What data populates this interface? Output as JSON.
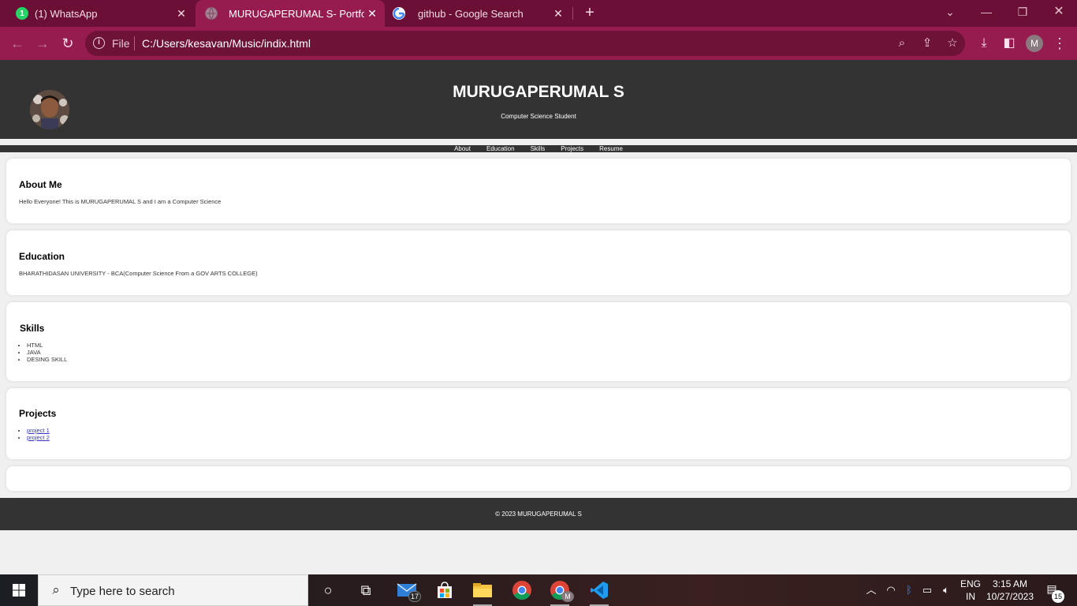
{
  "browser": {
    "tabs": [
      {
        "title": "(1) WhatsApp",
        "icon": "whatsapp-icon",
        "badge": "1",
        "active": false
      },
      {
        "title": "MURUGAPERUMAL S- Portfolio",
        "icon": "globe-icon",
        "active": true
      },
      {
        "title": "github - Google Search",
        "icon": "google-icon",
        "active": false
      }
    ],
    "new_tab": "+",
    "address": {
      "scheme_label": "File",
      "url": "C:/Users/kesavan/Music/indix.html"
    },
    "profile_initial": "M",
    "colors": {
      "frame": "#6b0f36",
      "toolbar": "#961b4f",
      "omnibox": "#6f1238"
    }
  },
  "site": {
    "header": {
      "title": "MURUGAPERUMAL S",
      "subtitle": "Computer Science Student"
    },
    "nav": [
      "About",
      "Education",
      "Skills",
      "Projects",
      "Resume"
    ],
    "about": {
      "heading": "About Me",
      "text": "Hello Everyone! This is MURUGAPERUMAL S and I am a Computer Science"
    },
    "education": {
      "heading": "Education",
      "text": "BHARATHIDASAN UNIVERSITY - BCA(Computer Science From a GOV ARTS COLLEGE)"
    },
    "skills": {
      "heading": "Skills",
      "items": [
        "HTML",
        "JAVA",
        "DESING SKILL"
      ]
    },
    "projects": {
      "heading": "Projects",
      "items": [
        "project 1",
        "project 2"
      ]
    },
    "footer": "© 2023 MURUGAPERUMAL S",
    "colors": {
      "header_bg": "#333333",
      "page_bg": "#f0f0f0",
      "link": "#3333cc"
    }
  },
  "taskbar": {
    "search_placeholder": "Type here to search",
    "mail_badge": "17",
    "chrome_profile_badge": "M",
    "language": {
      "line1": "ENG",
      "line2": "IN"
    },
    "clock": {
      "time": "3:15 AM",
      "date": "10/27/2023"
    },
    "notifications_count": "15"
  }
}
